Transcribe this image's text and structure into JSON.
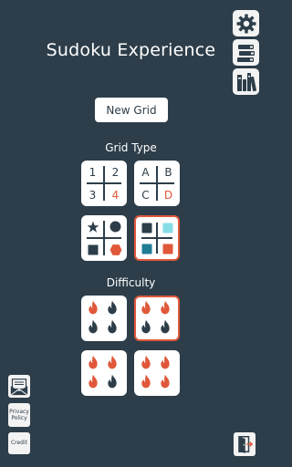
{
  "app_title": "Sudoku Experience",
  "new_grid_label": "New Grid",
  "grid_type": {
    "label": "Grid Type",
    "options": [
      {
        "cells": [
          "1",
          "2",
          "3",
          "4"
        ],
        "selected": false
      },
      {
        "cells": [
          "A",
          "B",
          "C",
          "D"
        ],
        "selected": false
      },
      {
        "icons": [
          "star-icon",
          "circle-icon",
          "square-icon",
          "hexagon-icon"
        ],
        "selected": false
      },
      {
        "icons": [
          "color-square-icon",
          "color-square-icon",
          "color-square-icon",
          "color-square-icon"
        ],
        "selected": true
      }
    ]
  },
  "difficulty": {
    "label": "Difficulty",
    "options": [
      {
        "flames_active": 1,
        "selected": false
      },
      {
        "flames_active": 2,
        "selected": true
      },
      {
        "flames_active": 3,
        "selected": false
      },
      {
        "flames_active": 4,
        "selected": false
      }
    ]
  },
  "sidebar": {
    "privacy_policy_label": "Privacy Policy",
    "credit_label": "Credit"
  },
  "colors": {
    "background": "#2d3e4a",
    "accent": "#e0583a",
    "teal": "#1f7d94",
    "light_teal": "#86dde6"
  },
  "icons": {
    "settings": "gear-icon",
    "library": "books-icon",
    "stats": "bookshelf-icon",
    "contact": "envelope-icon",
    "exit": "exit-door-icon"
  }
}
